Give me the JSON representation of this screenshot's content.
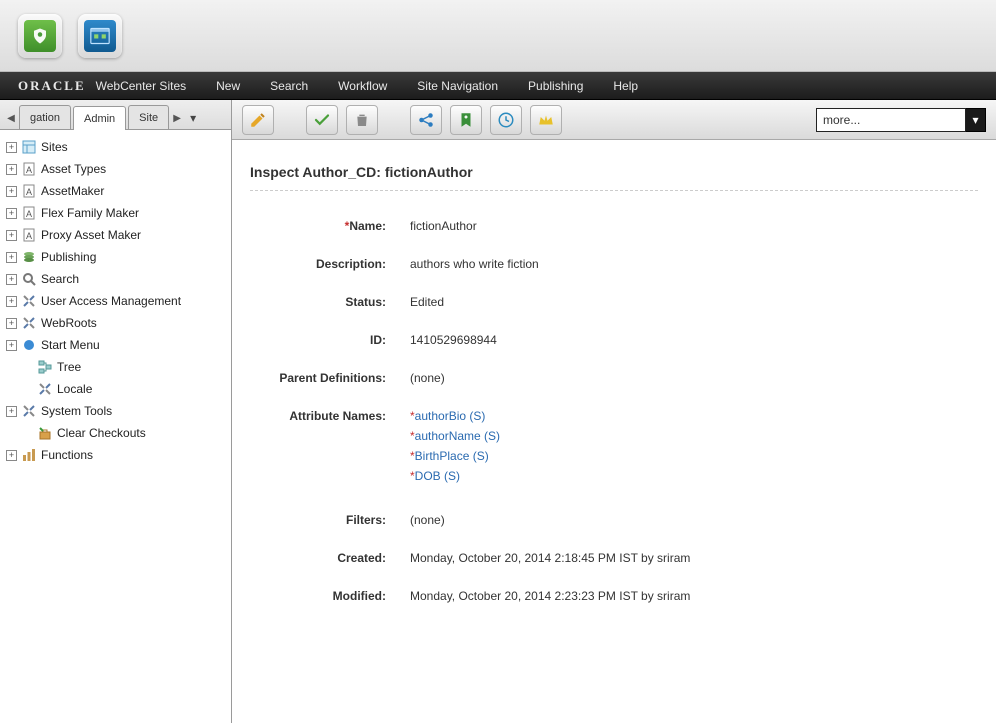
{
  "menubar": {
    "brand_main": "ORACLE",
    "brand_sub": "WebCenter Sites",
    "items": [
      "New",
      "Search",
      "Workflow",
      "Site Navigation",
      "Publishing",
      "Help"
    ]
  },
  "sidebar": {
    "tabs": {
      "left": "gation",
      "active": "Admin",
      "right": "Site"
    },
    "tree": [
      {
        "exp": true,
        "icon": "grid-icon",
        "label": "Sites"
      },
      {
        "exp": true,
        "icon": "doc-a-icon",
        "label": "Asset Types"
      },
      {
        "exp": true,
        "icon": "doc-a-icon",
        "label": "AssetMaker"
      },
      {
        "exp": true,
        "icon": "doc-a-icon",
        "label": "Flex Family Maker"
      },
      {
        "exp": true,
        "icon": "doc-a-icon",
        "label": "Proxy Asset Maker"
      },
      {
        "exp": true,
        "icon": "stack-icon",
        "label": "Publishing"
      },
      {
        "exp": true,
        "icon": "search-icon",
        "label": "Search"
      },
      {
        "exp": true,
        "icon": "tools-icon",
        "label": "User Access Management"
      },
      {
        "exp": true,
        "icon": "tools-icon",
        "label": "WebRoots"
      },
      {
        "exp": true,
        "icon": "dot-icon",
        "label": "Start Menu"
      },
      {
        "exp": false,
        "icon": "tree-icon",
        "label": "Tree",
        "indent": 1
      },
      {
        "exp": false,
        "icon": "tools-icon",
        "label": "Locale",
        "indent": 1
      },
      {
        "exp": true,
        "icon": "tools-icon",
        "label": "System Tools"
      },
      {
        "exp": false,
        "icon": "clear-icon",
        "label": "Clear Checkouts",
        "indent": 1
      },
      {
        "exp": true,
        "icon": "functions-icon",
        "label": "Functions"
      }
    ]
  },
  "toolbar": {
    "dropdown": "more..."
  },
  "page": {
    "title": "Inspect Author_CD: fictionAuthor",
    "labels": {
      "name": "Name:",
      "description": "Description:",
      "status": "Status:",
      "id": "ID:",
      "parent_defs": "Parent Definitions:",
      "attrs": "Attribute Names:",
      "filters": "Filters:",
      "created": "Created:",
      "modified": "Modified:"
    },
    "values": {
      "name": "fictionAuthor",
      "description": "authors who write fiction",
      "status": "Edited",
      "id": "1410529698944",
      "parent_defs": "(none)",
      "attributes": [
        "authorBio (S)",
        "authorName (S)",
        "BirthPlace (S)",
        "DOB (S)"
      ],
      "filters": "(none)",
      "created": "Monday, October 20, 2014 2:18:45 PM IST by sriram",
      "modified": "Monday, October 20, 2014 2:23:23 PM IST by sriram"
    }
  }
}
